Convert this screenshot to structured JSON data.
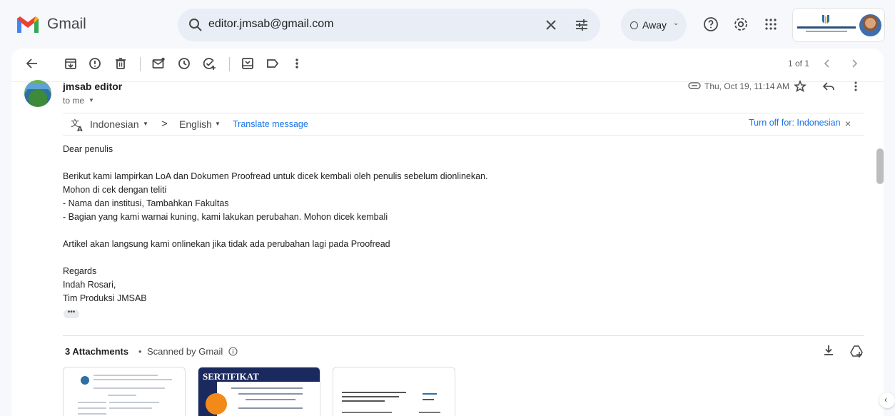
{
  "app": {
    "name": "Gmail"
  },
  "search": {
    "query": "editor.jmsab@gmail.com"
  },
  "status": {
    "label": "Away"
  },
  "toolbar": {
    "back": "back-arrow-icon",
    "actions": [
      "archive-icon",
      "report-spam-icon",
      "delete-icon",
      "mark-unread-icon",
      "snooze-icon",
      "add-task-icon",
      "move-to-icon",
      "label-icon",
      "more-vert-icon"
    ]
  },
  "pager": {
    "text": "1 of 1"
  },
  "message": {
    "sender": "jmsab editor",
    "to": "to me",
    "date": "Thu, Oct 19, 11:14 AM"
  },
  "translate": {
    "from": "Indonesian",
    "arrow": ">",
    "to": "English",
    "link": "Translate message",
    "turn_off": "Turn off for: Indonesian",
    "close": "×"
  },
  "body": {
    "l1": "Dear penulis",
    "l2": "Berikut kami lampirkan LoA dan Dokumen Proofread untuk dicek kembali oleh penulis sebelum dionlinekan.",
    "l3": "Mohon di cek dengan teliti",
    "l4": "- Nama dan institusi, Tambahkan Fakultas",
    "l5": "- Bagian yang kami warnai kuning, kami lakukan perubahan. Mohon dicek kembali",
    "l6": "Artikel akan langsung kami onlinekan jika tidak ada perubahan lagi pada Proofread",
    "l7": "Regards",
    "l8": "Indah Rosari,",
    "l9": "Tim Produksi JMSAB",
    "ellipsis": "•••"
  },
  "attachments": {
    "title": "3 Attachments",
    "dot": "•",
    "scanned": "Scanned by Gmail",
    "cert_title": "SERTIFIKAT"
  },
  "colors": {
    "accent": "#1a73e8",
    "search_bg": "#e9eef6",
    "page_bg": "#f6f8fc",
    "gmail_red": "#ea4335"
  }
}
